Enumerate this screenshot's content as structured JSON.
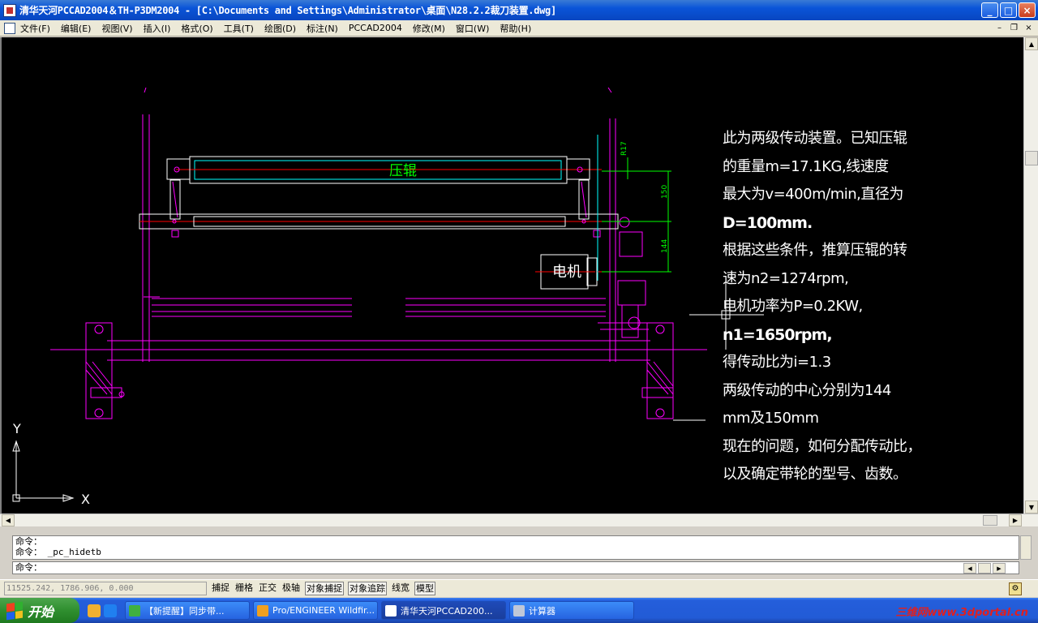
{
  "window": {
    "title": "清华天河PCCAD2004＆TH-P3DM2004 - [C:\\Documents and Settings\\Administrator\\桌面\\N28.2.2裁刀装置.dwg]",
    "minimize": "_",
    "maximize": "□",
    "close": "×"
  },
  "menu": {
    "items": [
      "文件(F)",
      "编辑(E)",
      "视图(V)",
      "插入(I)",
      "格式(O)",
      "工具(T)",
      "绘图(D)",
      "标注(N)",
      "PCCAD2004",
      "修改(M)",
      "窗口(W)",
      "帮助(H)"
    ],
    "mdi_minimize": "–",
    "mdi_restore": "❐",
    "mdi_close": "×"
  },
  "drawing": {
    "roller_label": "压辊",
    "motor_label": "电机",
    "dim_r17": "R17",
    "dim_150": "150",
    "dim_144": "144",
    "ucs_y": "Y",
    "ucs_x": "X",
    "notes": [
      "此为两级传动装置。已知压辊",
      "的重量m=17.1KG,线速度",
      "最大为v=400m/min,直径为",
      "D=100mm.",
      " 根据这些条件，推算压辊的转",
      "速为n2=1274rpm,",
      "电机功率为P=0.2KW,",
      "n1=1650rpm,",
      "得传动比为i=1.3",
      "两级传动的中心分别为144",
      "mm及150mm",
      "现在的问题，如何分配传动比，",
      "以及确定带轮的型号、齿数。"
    ]
  },
  "command": {
    "history": [
      "命令：",
      "命令： _pc_hidetb"
    ],
    "prompt": "命令："
  },
  "status": {
    "coords": "11525.242, 1786.906, 0.000",
    "toggles": [
      {
        "label": "捕捉",
        "on": false
      },
      {
        "label": "栅格",
        "on": false
      },
      {
        "label": "正交",
        "on": false
      },
      {
        "label": "极轴",
        "on": false
      },
      {
        "label": "对象捕捉",
        "on": true
      },
      {
        "label": "对象追踪",
        "on": true
      },
      {
        "label": "线宽",
        "on": false
      },
      {
        "label": "模型",
        "on": true
      }
    ]
  },
  "taskbar": {
    "start_label": "开始",
    "tasks": [
      {
        "label": "【新提醒】同步带...",
        "icon_color": "#40b040",
        "active": false
      },
      {
        "label": "Pro/ENGINEER Wildfir...",
        "icon_color": "#f0a020",
        "active": false
      },
      {
        "label": "清华天河PCCAD200...",
        "icon_color": "#ffffff",
        "active": true
      },
      {
        "label": "计算器",
        "icon_color": "#c0c8d8",
        "active": false
      }
    ],
    "watermark": "三维网www.3dportal.cn"
  },
  "colors": {
    "magenta": "#ff00ff",
    "cyan": "#00ffff",
    "green": "#00ff00",
    "red": "#ff0000",
    "white": "#ffffff",
    "taskbar_blue": "#245edb"
  }
}
